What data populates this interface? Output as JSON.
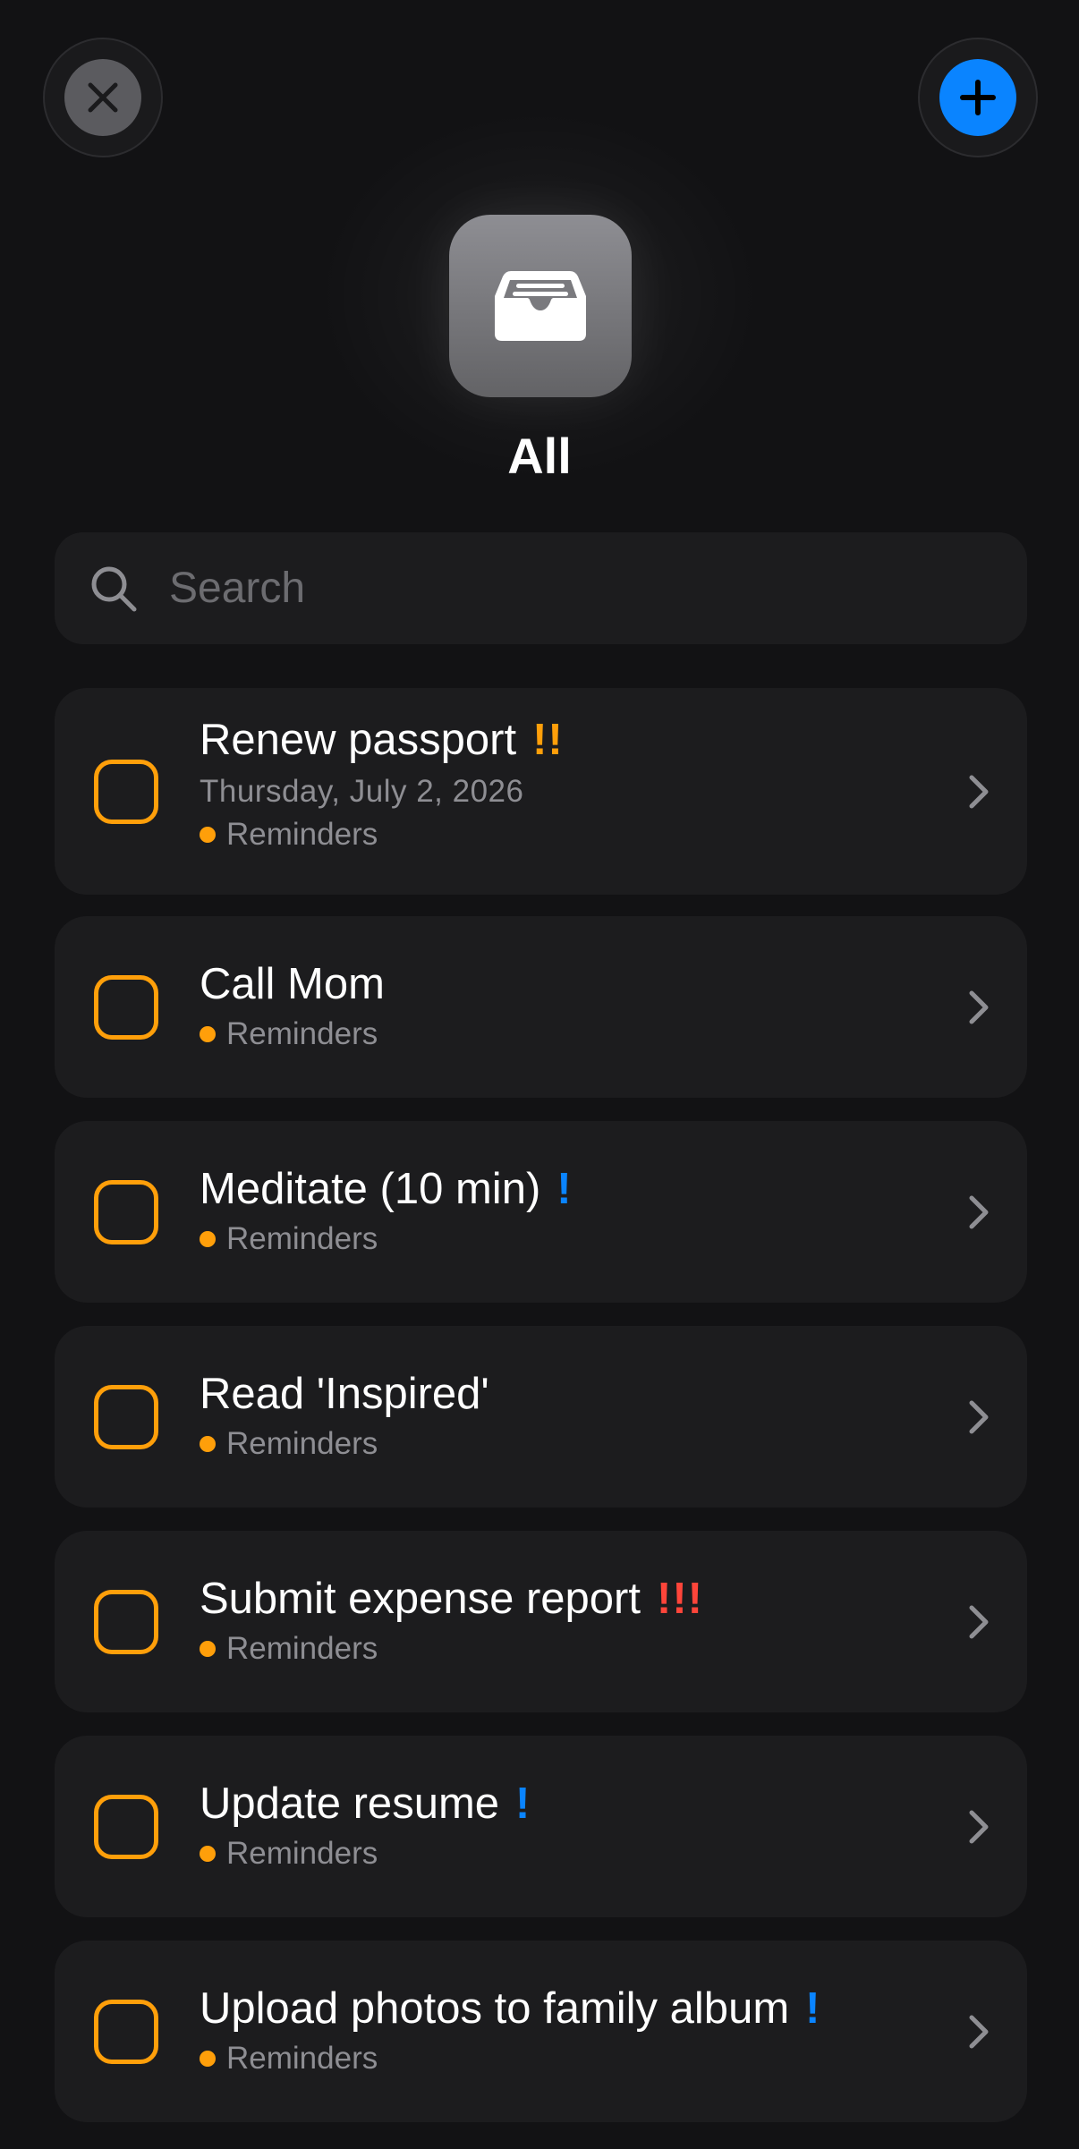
{
  "colors": {
    "background": "#121214",
    "card": "#1c1c1e",
    "accent_blue": "#0a84ff",
    "checkbox_orange": "#ff9f0a",
    "priority_orange": "#ff9f0a",
    "priority_red": "#ff453a",
    "priority_blue": "#0a84ff",
    "secondary_text": "#8e8e93"
  },
  "toolbar": {
    "close_icon": "close-icon",
    "add_icon": "plus-icon"
  },
  "header": {
    "icon": "tray-icon",
    "title": "All"
  },
  "search": {
    "placeholder": "Search",
    "value": ""
  },
  "reminders": [
    {
      "title": "Renew passport",
      "priority": "!!",
      "priority_color": "orange",
      "date": "Thursday, July 2, 2026",
      "list": "Reminders"
    },
    {
      "title": "Call Mom",
      "priority": "",
      "priority_color": "",
      "date": "",
      "list": "Reminders"
    },
    {
      "title": "Meditate (10 min)",
      "priority": "!",
      "priority_color": "blue",
      "date": "",
      "list": "Reminders"
    },
    {
      "title": "Read 'Inspired'",
      "priority": "",
      "priority_color": "",
      "date": "",
      "list": "Reminders"
    },
    {
      "title": "Submit expense report",
      "priority": "!!!",
      "priority_color": "red",
      "date": "",
      "list": "Reminders"
    },
    {
      "title": "Update resume",
      "priority": "!",
      "priority_color": "blue",
      "date": "",
      "list": "Reminders"
    },
    {
      "title": "Upload photos to family album",
      "priority": "!",
      "priority_color": "blue",
      "date": "",
      "list": "Reminders"
    }
  ]
}
